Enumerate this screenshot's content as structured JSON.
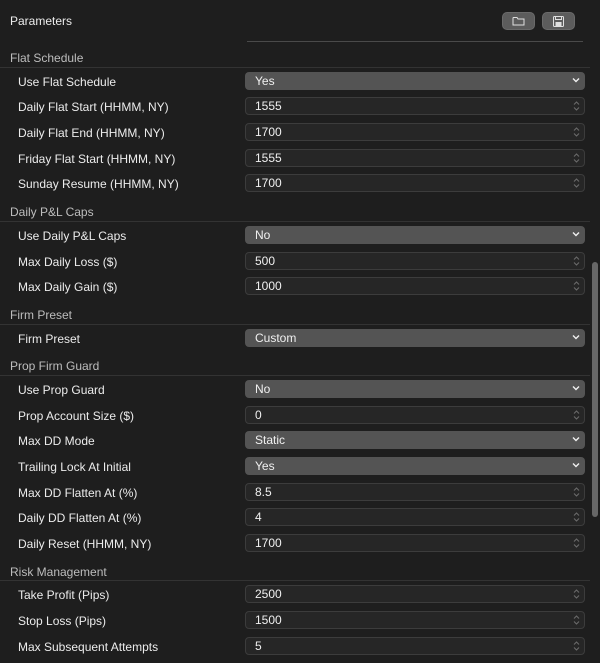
{
  "header": {
    "title": "Parameters"
  },
  "sections": [
    {
      "title": "Flat Schedule",
      "rows": [
        {
          "label": "Use Flat Schedule",
          "type": "select",
          "value": "Yes"
        },
        {
          "label": "Daily Flat Start (HHMM, NY)",
          "type": "number",
          "value": "1555"
        },
        {
          "label": "Daily Flat End (HHMM, NY)",
          "type": "number",
          "value": "1700"
        },
        {
          "label": "Friday Flat Start (HHMM, NY)",
          "type": "number",
          "value": "1555"
        },
        {
          "label": "Sunday Resume (HHMM, NY)",
          "type": "number",
          "value": "1700"
        }
      ]
    },
    {
      "title": "Daily P&L Caps",
      "rows": [
        {
          "label": "Use Daily P&L Caps",
          "type": "select",
          "value": "No"
        },
        {
          "label": "Max Daily Loss ($)",
          "type": "number",
          "value": "500"
        },
        {
          "label": "Max Daily Gain ($)",
          "type": "number",
          "value": "1000"
        }
      ]
    },
    {
      "title": "Firm Preset",
      "rows": [
        {
          "label": "Firm Preset",
          "type": "select",
          "value": "Custom"
        }
      ]
    },
    {
      "title": "Prop Firm Guard",
      "rows": [
        {
          "label": "Use Prop Guard",
          "type": "select",
          "value": "No"
        },
        {
          "label": "Prop Account Size ($)",
          "type": "number",
          "value": "0"
        },
        {
          "label": "Max DD Mode",
          "type": "select",
          "value": "Static"
        },
        {
          "label": "Trailing Lock At Initial",
          "type": "select",
          "value": "Yes"
        },
        {
          "label": "Max DD Flatten At (%)",
          "type": "number",
          "value": "8.5"
        },
        {
          "label": "Daily DD Flatten At (%)",
          "type": "number",
          "value": "4"
        },
        {
          "label": "Daily Reset (HHMM, NY)",
          "type": "number",
          "value": "1700"
        }
      ]
    },
    {
      "title": "Risk Management",
      "rows": [
        {
          "label": "Take Profit (Pips)",
          "type": "number",
          "value": "2500"
        },
        {
          "label": "Stop Loss (Pips)",
          "type": "number",
          "value": "1500"
        },
        {
          "label": "Max Subsequent Attempts",
          "type": "number",
          "value": "5"
        }
      ]
    }
  ]
}
